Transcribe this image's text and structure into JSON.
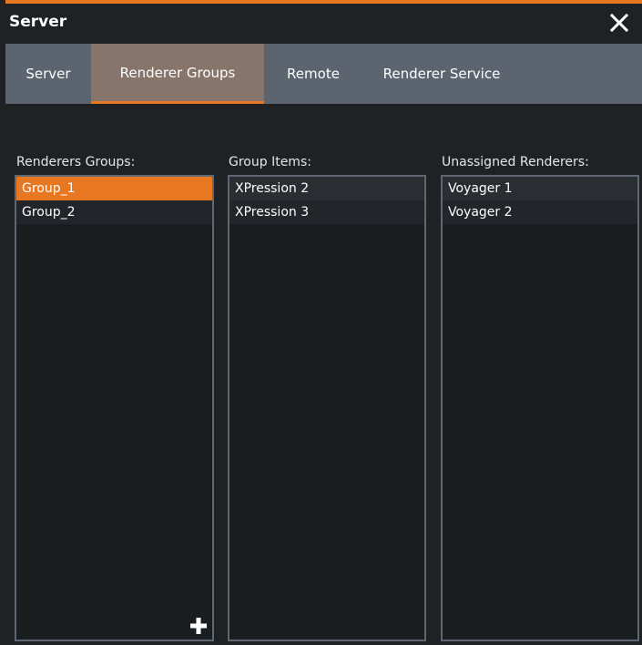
{
  "window": {
    "title": "Server",
    "accent_color": "#e87722"
  },
  "tabs": [
    {
      "label": "Server",
      "active": false
    },
    {
      "label": "Renderer Groups",
      "active": true
    },
    {
      "label": "Remote",
      "active": false
    },
    {
      "label": "Renderer Service",
      "active": false
    }
  ],
  "columns": {
    "groups": {
      "label": "Renderers Groups:",
      "items": [
        "Group_1",
        "Group_2"
      ],
      "selected_index": 0
    },
    "group_items": {
      "label": "Group Items:",
      "items": [
        "XPression 2",
        "XPression 3"
      ]
    },
    "unassigned": {
      "label": "Unassigned Renderers:",
      "items": [
        "Voyager 1",
        "Voyager 2"
      ]
    }
  },
  "icons": {
    "close": "close-icon",
    "add": "plus-icon"
  }
}
